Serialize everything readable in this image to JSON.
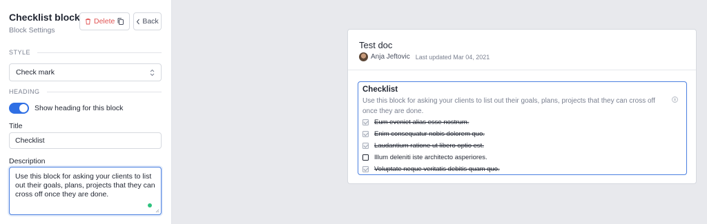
{
  "sidebar": {
    "title": "Checklist block",
    "subtitle": "Block Settings",
    "delete_label": "Delete",
    "back_label": "Back",
    "style_section": "STYLE",
    "style_value": "Check mark",
    "heading_section": "HEADING",
    "toggle_label": "Show heading for this block",
    "toggle_on": true,
    "title_label": "Title",
    "title_value": "Checklist",
    "description_label": "Description",
    "description_value": "Use this block for asking your clients to list out their goals, plans, projects that they can cross off once they are done."
  },
  "document": {
    "title": "Test doc",
    "author": "Anja Jeftovic",
    "updated": "Last updated Mar 04, 2021",
    "block": {
      "title": "Checklist",
      "description": "Use this block for asking your clients to list out their goals, plans, projects that they can cross off once they are done.",
      "items": [
        {
          "text": "Eum eveniet alias esse nostrum.",
          "checked": true
        },
        {
          "text": "Enim consequatur nobis dolorem quo.",
          "checked": true
        },
        {
          "text": "Laudantium ratione ut libero optio est.",
          "checked": true
        },
        {
          "text": "Illum deleniti iste architecto asperiores.",
          "checked": false
        },
        {
          "text": "Voluptate neque veritatis debitis quam quo.",
          "checked": true
        }
      ]
    }
  },
  "colors": {
    "accent": "#2f6fe4",
    "danger": "#e05252",
    "success": "#2ec27e",
    "background": "#e8e9ed"
  }
}
